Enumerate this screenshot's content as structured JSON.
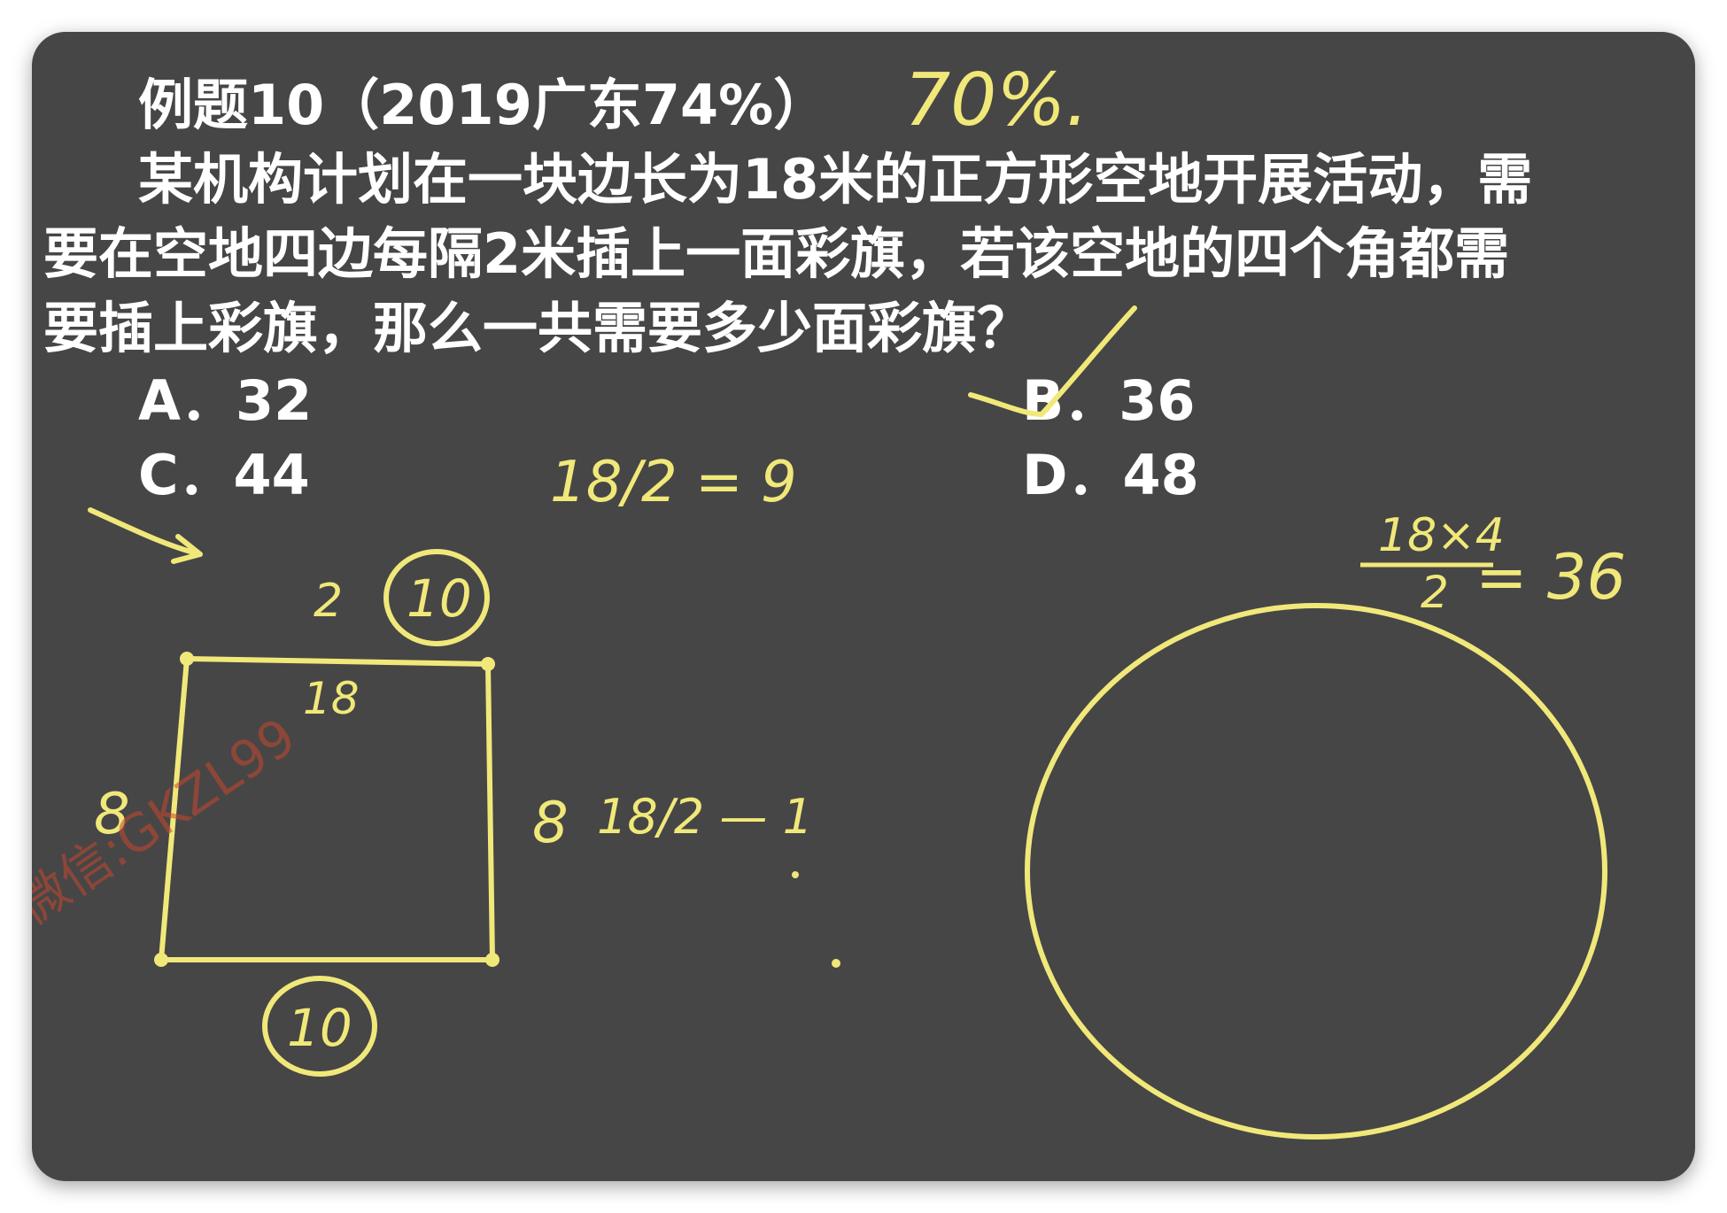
{
  "problem": {
    "title": "例题10（2019广东74%）",
    "lines": [
      "某机构计划在一块边长为18米的正方形空地开展活动，需",
      "要在空地四边每隔2米插上一面彩旗，若该空地的四个角都需",
      "要插上彩旗，那么一共需要多少面彩旗？"
    ],
    "options": [
      {
        "letter": "A",
        "text": "A．32"
      },
      {
        "letter": "B",
        "text": "B．36"
      },
      {
        "letter": "C",
        "text": "C．44"
      },
      {
        "letter": "D",
        "text": "D．48"
      }
    ]
  },
  "annotations": {
    "accuracy_note": "70%.",
    "calc_top": "18/2 = 9",
    "side_top_interval": "2",
    "side_top_count": "10",
    "square_side_label": "18",
    "left_side_count": "8",
    "right_side_count": "8",
    "right_side_calc": "18/2 — 1",
    "bottom_side_count": "10",
    "circle_calc_numerator": "18×4",
    "circle_calc_denominator": "2",
    "circle_calc_result": "= 36"
  },
  "watermark": {
    "text": "微信:GKZL99"
  },
  "colors": {
    "board": "#464646",
    "ink": "#f1e87a",
    "text": "#ffffff",
    "watermark": "#c8472e"
  }
}
